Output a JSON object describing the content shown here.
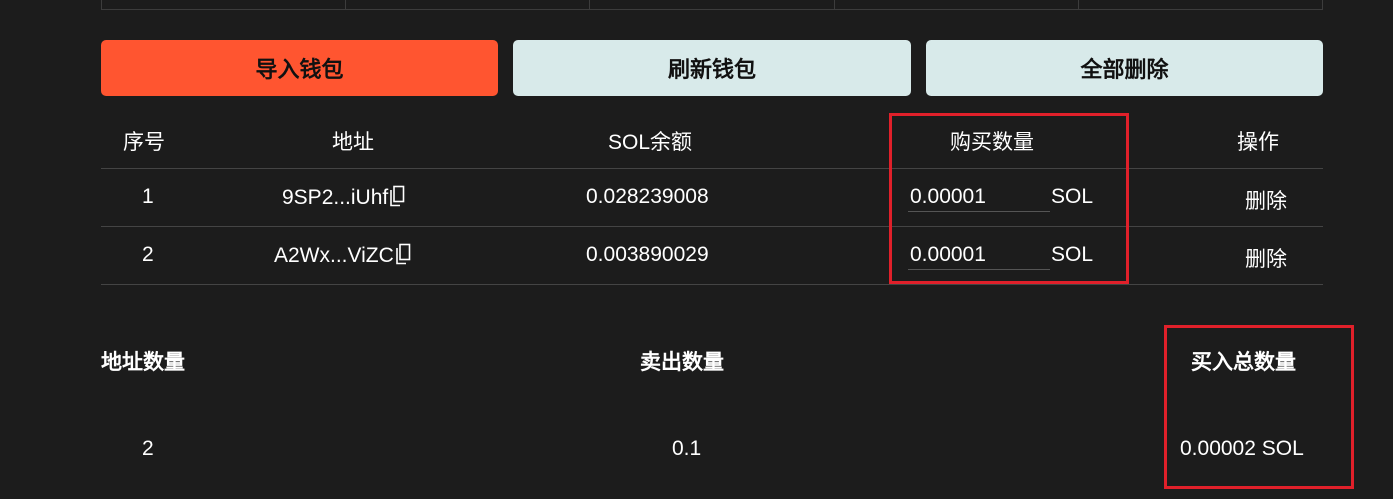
{
  "toolbar": {
    "import_label": "导入钱包",
    "refresh_label": "刷新钱包",
    "delete_all_label": "全部删除"
  },
  "table": {
    "headers": {
      "index": "序号",
      "address": "地址",
      "sol_balance": "SOL余额",
      "buy_amount": "购买数量",
      "action": "操作"
    },
    "rows": [
      {
        "index": "1",
        "address": "9SP2...iUhf",
        "balance": "0.028239008",
        "buy_amount": "0.00001",
        "unit": "SOL",
        "action": "删除"
      },
      {
        "index": "2",
        "address": "A2Wx...ViZC",
        "balance": "0.003890029",
        "buy_amount": "0.00001",
        "unit": "SOL",
        "action": "删除"
      }
    ]
  },
  "summary": {
    "address_count_label": "地址数量",
    "sell_amount_label": "卖出数量",
    "total_buy_label": "买入总数量",
    "address_count": "2",
    "sell_amount": "0.1",
    "total_buy": "0.00002 SOL"
  },
  "colors": {
    "accent": "#ff5530",
    "secondary_button": "#d8eaea",
    "highlight_box": "#e0202a",
    "background": "#1c1c1c"
  },
  "icons": {
    "copy": "copy-icon"
  }
}
